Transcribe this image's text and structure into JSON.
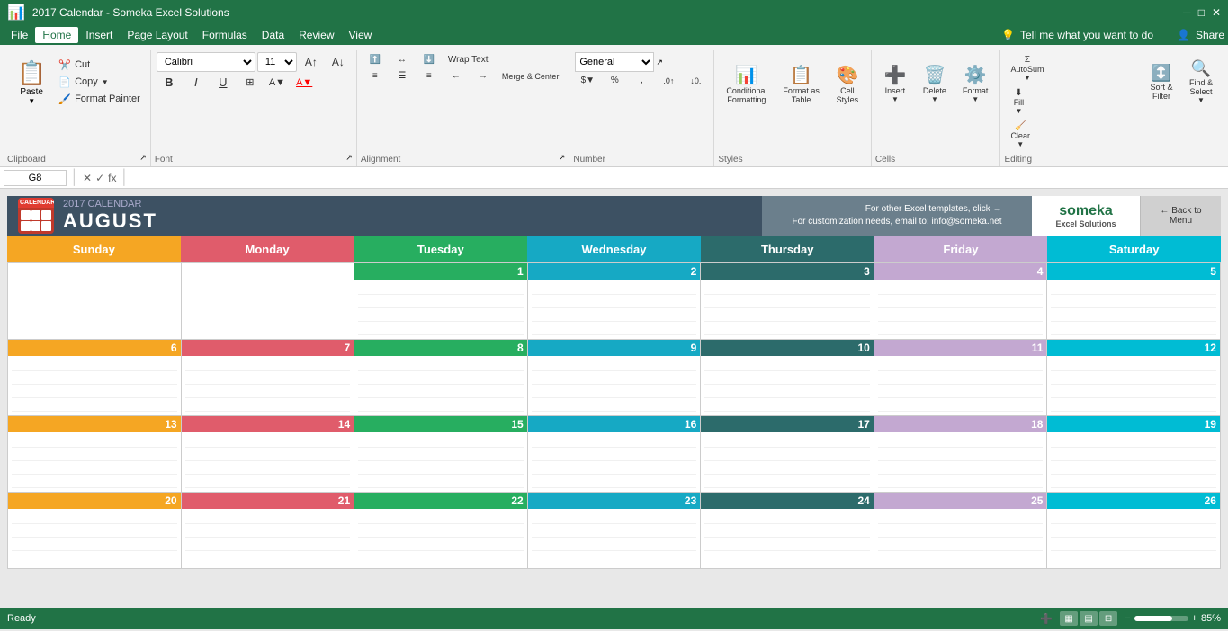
{
  "titlebar": {
    "filename": "2017 Calendar - Someka Excel Solutions",
    "share": "Share"
  },
  "menubar": {
    "items": [
      "File",
      "Home",
      "Insert",
      "Page Layout",
      "Formulas",
      "Data",
      "Review",
      "View"
    ],
    "active": "Home",
    "tell_me": "Tell me what you want to do",
    "share": "Share"
  },
  "ribbon": {
    "clipboard": {
      "label": "Clipboard",
      "paste": "Paste",
      "cut": "Cut",
      "copy": "Copy",
      "format_painter": "Format Painter"
    },
    "font": {
      "label": "Font",
      "family": "Calibri",
      "size": "11",
      "bold": "B",
      "italic": "I",
      "underline": "U"
    },
    "alignment": {
      "label": "Alignment",
      "wrap_text": "Wrap Text",
      "merge": "Merge & Center"
    },
    "number": {
      "label": "Number",
      "format": "General",
      "percent": "%",
      "comma": ","
    },
    "styles": {
      "label": "Styles",
      "conditional": "Conditional\nFormatting",
      "format_table": "Format as\nTable",
      "cell_styles": "Cell\nStyles"
    },
    "cells": {
      "label": "Cells",
      "insert": "Insert",
      "delete": "Delete",
      "format": "Format"
    },
    "editing": {
      "label": "Editing",
      "autosum": "AutoSum",
      "fill": "Fill",
      "clear": "Clear",
      "sort_filter": "Sort &\nFilter",
      "find_select": "Find &\nSelect"
    }
  },
  "formula_bar": {
    "cell_ref": "G8",
    "formula": ""
  },
  "calendar": {
    "year": "2017 CALENDAR",
    "month": "AUGUST",
    "header_info_line1": "For other Excel templates, click →",
    "header_info_line2": "For customization needs, email to: info@someka.net",
    "logo_text": "someka",
    "logo_sub": "Excel Solutions",
    "back_btn": "Back to\nMenu",
    "days": [
      "Sunday",
      "Monday",
      "Tuesday",
      "Wednesday",
      "Thursday",
      "Friday",
      "Saturday"
    ],
    "day_colors": [
      "#f5a623",
      "#e05c6b",
      "#27ae60",
      "#16a9c4",
      "#2c6b6b",
      "#c3a8d1",
      "#00bcd4"
    ],
    "weeks": [
      [
        null,
        null,
        1,
        2,
        3,
        4,
        5
      ],
      [
        6,
        7,
        8,
        9,
        10,
        11,
        12
      ],
      [
        13,
        14,
        15,
        16,
        17,
        18,
        19
      ],
      [
        20,
        21,
        22,
        23,
        24,
        25,
        26
      ]
    ]
  },
  "statusbar": {
    "status": "Ready",
    "zoom": "85%"
  }
}
